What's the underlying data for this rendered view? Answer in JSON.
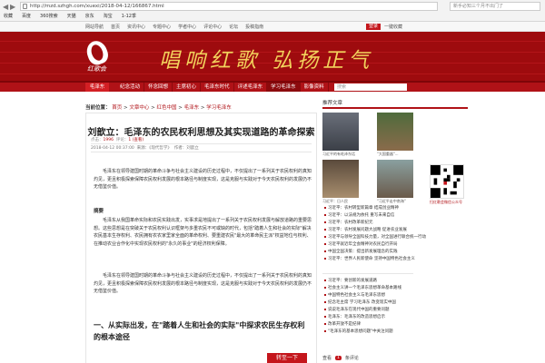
{
  "browser": {
    "url": "http://mzd.szhgh.com/xuexi/2018-04-12/166867.html",
    "search_placeholder": "新手必知三个月不出门了",
    "bookmarks": [
      "收藏",
      "百度",
      "360搜索",
      "天猫",
      "京东",
      "淘宝",
      "1-12季"
    ]
  },
  "topbar": {
    "links": [
      "网站导航",
      "首页",
      "资讯中心",
      "专题中心",
      "学者中心",
      "评论中心",
      "论坛",
      "投稿指南"
    ],
    "login": "登录",
    "collect": "一键收藏"
  },
  "banner": {
    "logo_text": "红歌会",
    "slogan": "唱响红歌 弘扬正气"
  },
  "menu": {
    "brand": "毛泽东",
    "items": [
      "纪念活动",
      "怀念回想",
      "主席初心",
      "毛泽东时代",
      "评述毛泽东",
      "学习毛泽东",
      "影像资料"
    ],
    "active_index": 5,
    "search_placeholder": "搜索"
  },
  "breadcrumb": {
    "label": "当前位置：",
    "items": [
      "首页",
      "文章中心",
      "红色中国",
      "毛泽东",
      "学习毛泽东"
    ]
  },
  "article": {
    "title": "刘歆立：毛泽东的农民权利思想及其实现道路的革命探索",
    "meta_hits_label": "点击：",
    "meta_hits": "1996",
    "meta_comments_label": "评论：",
    "meta_comments": "1",
    "meta_list_label": "(查看)",
    "meta_date": "2018-04-12 00:37:00",
    "meta_source": "来源：《现代哲学》",
    "meta_author": "作者：刘歆立",
    "p1": "毛泽东在领导建国时期的革命斗争与社会主义建设的历史过程中，不仅提出了一系列关于农民权利的真知灼见，更且积极探索保障农民权利发展的根本路径与制度实现，这是克服与实践对于今天农民权利的发展仍不无借鉴价值。",
    "abstract_label": "摘要",
    "p2": "毛泽东从我国革命实际和农民实践出发，实事求是地提出了一系列关于农民权利发展与解放道路的重要思想。这些思想是在突破关于农民权利认识框架与多重农民不可或缺的时代，包括\"踏着人生和社会的实际\"解决农民基本生存权利、农民拥有农农家里家全面的革命权利、要重建农民\"最大的革命民主派\"权益地位与权利、在推动农业合作化中实现农民权利的\"永久的事业\"的经济权利保障。",
    "p3": "毛泽东在领导建国时期的革命斗争与社会主义建设的历史过程中，不仅提出了一系列关于农民权利的真知灼见，更且积极探索保障农民权利发展的根本路径与制度实现，这是克服与实践对于今天农民权利的发展仍不无借鉴价值。",
    "heading": "一、从实际出发，在\"踏着人生和社会的实际\"中探求农民生存权利的根本途径",
    "next_page": "转至一下"
  },
  "aside": {
    "header": "推荐文章",
    "captions": [
      "习近平的有毛泽东话",
      "\"大国重器\"...",
      "习近平：日人民",
      "\"习近平走中南海\""
    ],
    "qr_label": "扫红歌会微信公众号",
    "links": [
      "习近平：农村转型新篇章 结成创业精神",
      "习近平：以法规为依托 重写未来自信",
      "习近平：农村改革新纪元",
      "习近平：农村发展问题大战略 促进农业发展",
      "习近平与领导全国科技力量，对全国进行联合统一行动",
      "习近平就近年全会精神对农民自行开局",
      "中国全国决策：提出新发展理念的实践",
      "习近平：世界人民新使命 坚持中国特色社会主义"
    ],
    "links2": [
      "习近平：要创新的发展道路",
      "社会主义讲一个毛泽东思想革命基本路线",
      "中国特色社会主义与毛泽东思想",
      "纪念毛主席 学习毛泽东 改变现实中国",
      "说说毛泽东在现代中国的重要问题",
      "毛泽东：毛泽东的改造思想启示",
      "改革开放不是纪律",
      "\"毛泽东的基本思想问题\"中关注问题"
    ]
  },
  "share": {
    "label": "查看",
    "count": "1",
    "suffix": "条评论"
  }
}
